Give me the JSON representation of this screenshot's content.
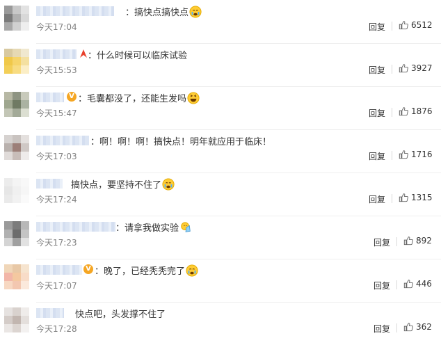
{
  "reply_label": "回复",
  "comments": [
    {
      "text": "：搞快点搞快点",
      "time": "今天17:04",
      "likes": "6512",
      "emoji": "cry"
    },
    {
      "text": "：什么时候可以临床试验",
      "time": "今天15:53",
      "likes": "3927",
      "emoji": ""
    },
    {
      "text": "：毛囊都没了，还能生发吗",
      "time": "今天15:47",
      "likes": "1876",
      "emoji": "laugh"
    },
    {
      "text": "：啊！啊！啊！搞快点！明年就应用于临床！",
      "time": "今天17:03",
      "likes": "1716",
      "emoji": ""
    },
    {
      "text": "搞快点，要坚持不住了",
      "time": "今天17:24",
      "likes": "1315",
      "emoji": "cry"
    },
    {
      "text": "：请拿我做实验",
      "time": "今天17:23",
      "likes": "892",
      "emoji": "pray"
    },
    {
      "text": "：晚了，已经秃秃完了",
      "time": "今天17:07",
      "likes": "446",
      "emoji": "cry"
    },
    {
      "text": "快点吧，头发撑不住了",
      "time": "今天17:28",
      "likes": "362",
      "emoji": ""
    }
  ],
  "colors": {
    "text": "#333333",
    "time": "#808080",
    "divider": "#eeeeee",
    "verified_badge": "#f5a623"
  },
  "icons": {
    "like": "thumbs-up-icon",
    "verified": "verified-v-icon",
    "emoji_cry": "crying-face-emoji",
    "emoji_laugh": "laughing-face-emoji",
    "emoji_pray": "pray-emoji"
  }
}
